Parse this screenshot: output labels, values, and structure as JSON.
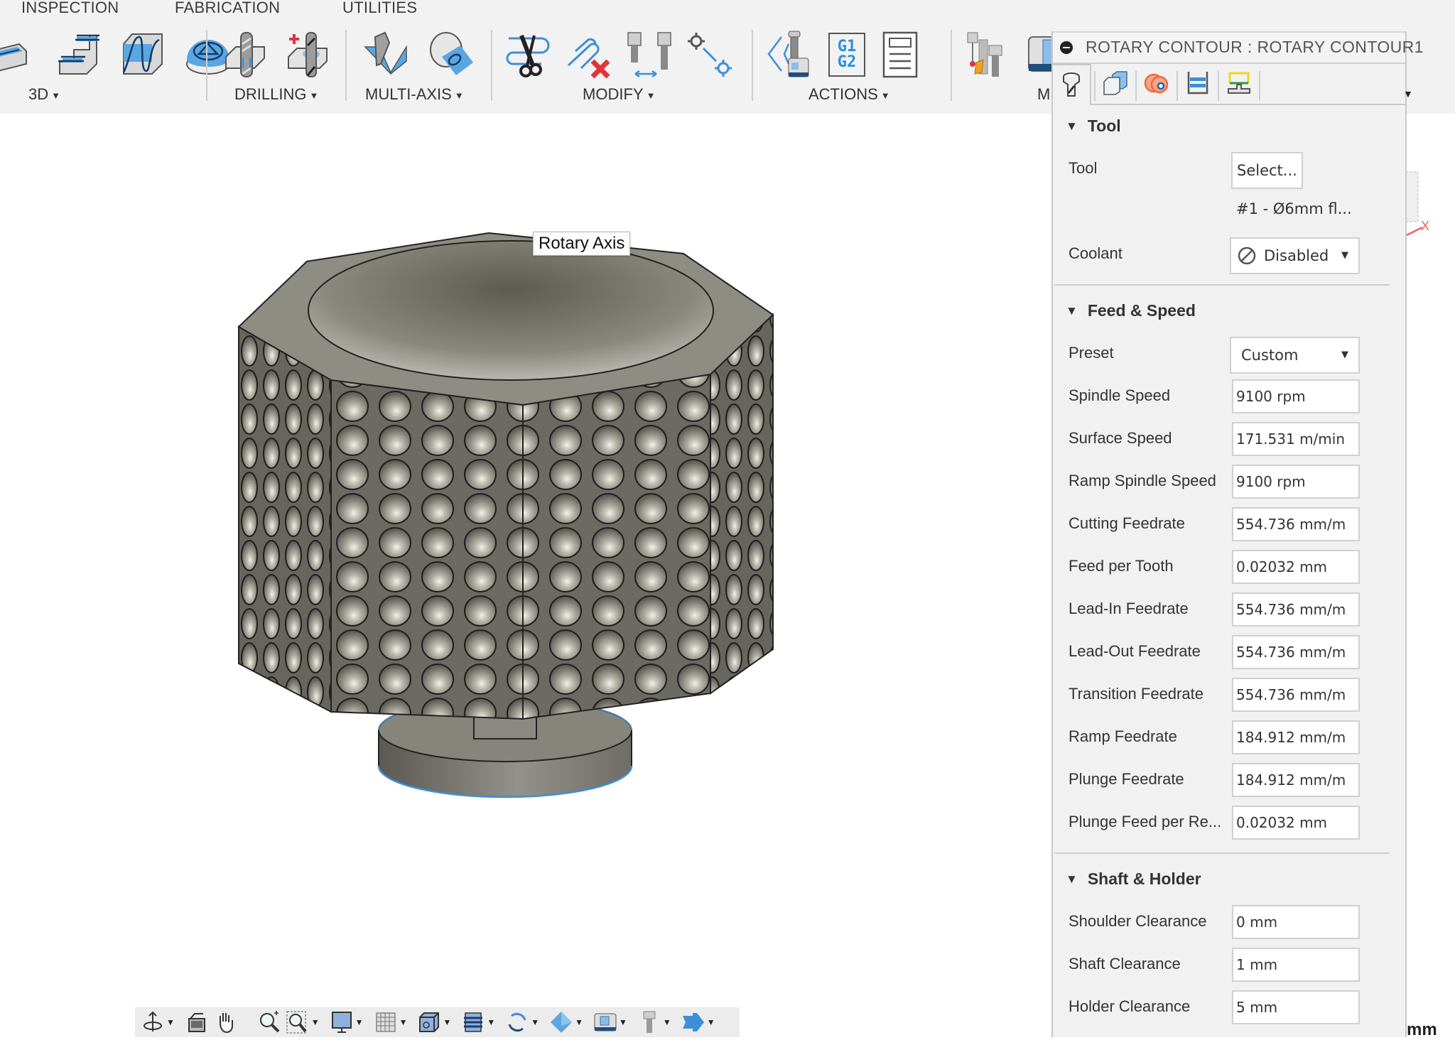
{
  "ribbon": {
    "tabs": [
      "INSPECTION",
      "FABRICATION",
      "UTILITIES"
    ],
    "groups": [
      {
        "label": "3D",
        "icons": [
          "3d-adaptive-clearing-icon",
          "3d-horizontal-icon",
          "3d-parallel-icon",
          "3d-scallop-icon"
        ]
      },
      {
        "label": "DRILLING",
        "icons": [
          "drill-icon",
          "hole-recognition-icon"
        ]
      },
      {
        "label": "MULTI-AXIS",
        "icons": [
          "swarf-icon",
          "rotary-icon"
        ]
      },
      {
        "label": "MODIFY",
        "icons": [
          "trim-toolpath-icon",
          "delete-toolpath-icon",
          "tool-change-icon",
          "move-point-icon"
        ]
      },
      {
        "label": "ACTIONS",
        "icons": [
          "simulate-icon",
          "post-process-gcode-icon",
          "setup-sheet-icon"
        ]
      },
      {
        "label": "M",
        "icons": [
          "tool-library-icon",
          "machine-icon"
        ]
      }
    ],
    "gcode_text": [
      "G1",
      "G2"
    ]
  },
  "viewport": {
    "tooltip": "Rotary Axis",
    "viewcube_axis": "X",
    "units": "mm"
  },
  "navbar": {
    "buttons": [
      {
        "icon": "orbit-icon",
        "dropdown": true
      },
      {
        "icon": "look-at-icon",
        "dropdown": false
      },
      {
        "icon": "pan-hand-icon",
        "dropdown": false
      },
      {
        "icon": "zoom-icon",
        "dropdown": false
      },
      {
        "icon": "zoom-window-icon",
        "dropdown": true
      },
      {
        "icon": "display-settings-icon",
        "dropdown": true
      },
      {
        "icon": "grid-icon",
        "dropdown": true
      },
      {
        "icon": "view-cube-icon",
        "dropdown": true
      },
      {
        "icon": "toolpath-display-icon",
        "dropdown": true
      },
      {
        "icon": "rotate-icon",
        "dropdown": true
      },
      {
        "icon": "stock-icon",
        "dropdown": true
      },
      {
        "icon": "machine-view-icon",
        "dropdown": true
      },
      {
        "icon": "tool-view-icon",
        "dropdown": true
      },
      {
        "icon": "connector-icon",
        "dropdown": true
      }
    ]
  },
  "panel": {
    "title": "ROTARY CONTOUR : ROTARY CONTOUR1",
    "tabs": [
      {
        "name": "tool-tab",
        "active": true
      },
      {
        "name": "geometry-tab",
        "active": false
      },
      {
        "name": "heights-tab",
        "active": false
      },
      {
        "name": "passes-tab",
        "active": false
      },
      {
        "name": "linking-tab",
        "active": false
      }
    ],
    "sections": {
      "tool": {
        "heading": "Tool",
        "tool_label": "Tool",
        "select_button": "Select...",
        "tool_description": "#1 - Ø6mm fl...",
        "coolant_label": "Coolant",
        "coolant_value": "Disabled"
      },
      "feed_speed": {
        "heading": "Feed & Speed",
        "preset_label": "Preset",
        "preset_value": "Custom",
        "fields": [
          {
            "label": "Spindle Speed",
            "value": "9100 rpm"
          },
          {
            "label": "Surface Speed",
            "value": "171.531 m/min"
          },
          {
            "label": "Ramp Spindle Speed",
            "value": "9100 rpm"
          },
          {
            "label": "Cutting Feedrate",
            "value": "554.736 mm/m"
          },
          {
            "label": "Feed per Tooth",
            "value": "0.02032 mm"
          },
          {
            "label": "Lead-In Feedrate",
            "value": "554.736 mm/m"
          },
          {
            "label": "Lead-Out Feedrate",
            "value": "554.736 mm/m"
          },
          {
            "label": "Transition Feedrate",
            "value": "554.736 mm/m"
          },
          {
            "label": "Ramp Feedrate",
            "value": "184.912 mm/m"
          },
          {
            "label": "Plunge Feedrate",
            "value": "184.912 mm/m"
          },
          {
            "label": "Plunge Feed per Re...",
            "value": "0.02032 mm"
          }
        ]
      },
      "shaft_holder": {
        "heading": "Shaft & Holder",
        "fields": [
          {
            "label": "Shoulder Clearance",
            "value": "0 mm"
          },
          {
            "label": "Shaft Clearance",
            "value": "1 mm"
          },
          {
            "label": "Holder Clearance",
            "value": "5 mm"
          }
        ]
      }
    }
  },
  "colors": {
    "accent_blue": "#3d8fd8",
    "ribbon_bg": "#f2f2f2",
    "panel_bg": "#f1f1f1",
    "model_gray": "#7c7b72",
    "delete_red": "#e0343a"
  }
}
